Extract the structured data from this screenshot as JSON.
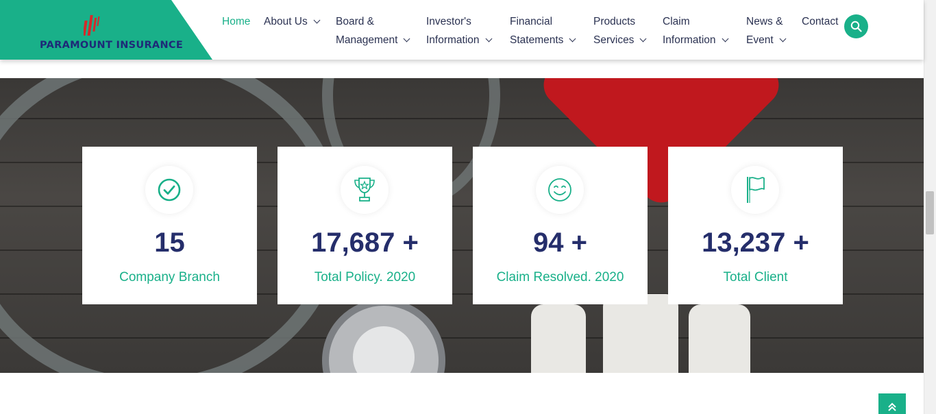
{
  "brand": {
    "name": "PARAMOUNT INSURANCE",
    "accent": "#19b089",
    "dark": "#252e6b"
  },
  "nav": {
    "home": "Home",
    "about": "About Us",
    "board_1": "Board &",
    "board_2": "Management",
    "investor_1": "Investor's",
    "investor_2": "Information",
    "financial_1": "Financial",
    "financial_2": "Statements",
    "products_1": "Products",
    "products_2": "Services",
    "claim_1": "Claim",
    "claim_2": "Information",
    "news_1": "News &",
    "news_2": "Event",
    "contact": "Contact"
  },
  "stats": [
    {
      "icon": "check-circle-icon",
      "value": "15",
      "label": "Company Branch"
    },
    {
      "icon": "trophy-icon",
      "value": "17,687 +",
      "label": "Total Policy. 2020"
    },
    {
      "icon": "smiley-icon",
      "value": "94 +",
      "label": "Claim Resolved. 2020"
    },
    {
      "icon": "flag-icon",
      "value": "13,237 +",
      "label": "Total Client"
    }
  ]
}
